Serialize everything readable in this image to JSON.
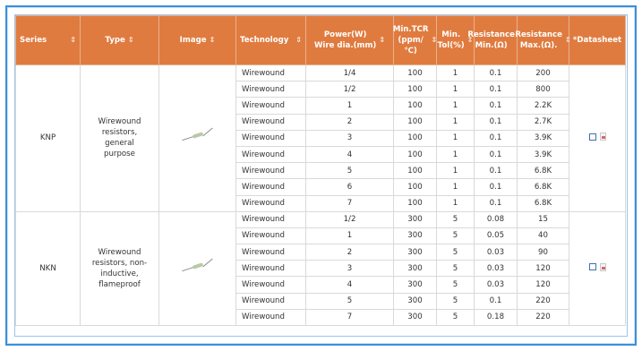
{
  "table": {
    "headers": [
      {
        "key": "series",
        "label": "Series",
        "sort": "⇕"
      },
      {
        "key": "type",
        "label": "Type",
        "sort": "⇕"
      },
      {
        "key": "image",
        "label": "Image",
        "sort": "⇕"
      },
      {
        "key": "technology",
        "label": "Technology",
        "sort": "⇕"
      },
      {
        "key": "power",
        "label": "Power(W)\nWire dia.(mm)",
        "sort": "⇕"
      },
      {
        "key": "tcr",
        "label": "Min.TCR\n(ppm/℃)",
        "sort": "⇕"
      },
      {
        "key": "tol",
        "label": "Min.\nTol(%)",
        "sort": "⇕"
      },
      {
        "key": "rmin",
        "label": "Resistance\nMin.(Ω)",
        "sort": "⇕"
      },
      {
        "key": "rmax",
        "label": "Resistance\nMax.(Ω).",
        "sort": "⇕"
      },
      {
        "key": "datasheet",
        "label": "*Datasheet",
        "sort": ""
      }
    ],
    "groups": [
      {
        "series": "KNP",
        "type": "Wirewound resistors, general purpose",
        "image_icon": "resistor-icon",
        "datasheet_icon": "pdf-icon",
        "rows": [
          {
            "technology": "Wirewound",
            "power": "1/4",
            "tcr": "100",
            "tol": "1",
            "rmin": "0.1",
            "rmax": "200"
          },
          {
            "technology": "Wirewound",
            "power": "1/2",
            "tcr": "100",
            "tol": "1",
            "rmin": "0.1",
            "rmax": "800"
          },
          {
            "technology": "Wirewound",
            "power": "1",
            "tcr": "100",
            "tol": "1",
            "rmin": "0.1",
            "rmax": "2.2K"
          },
          {
            "technology": "Wirewound",
            "power": "2",
            "tcr": "100",
            "tol": "1",
            "rmin": "0.1",
            "rmax": "2.7K"
          },
          {
            "technology": "Wirewound",
            "power": "3",
            "tcr": "100",
            "tol": "1",
            "rmin": "0.1",
            "rmax": "3.9K"
          },
          {
            "technology": "Wirewound",
            "power": "4",
            "tcr": "100",
            "tol": "1",
            "rmin": "0.1",
            "rmax": "3.9K"
          },
          {
            "technology": "Wirewound",
            "power": "5",
            "tcr": "100",
            "tol": "1",
            "rmin": "0.1",
            "rmax": "6.8K"
          },
          {
            "technology": "Wirewound",
            "power": "6",
            "tcr": "100",
            "tol": "1",
            "rmin": "0.1",
            "rmax": "6.8K"
          },
          {
            "technology": "Wirewound",
            "power": "7",
            "tcr": "100",
            "tol": "1",
            "rmin": "0.1",
            "rmax": "6.8K"
          }
        ]
      },
      {
        "series": "NKN",
        "type": "Wirewound resistors, non-inductive, flameproof",
        "image_icon": "resistor-icon",
        "datasheet_icon": "pdf-icon",
        "rows": [
          {
            "technology": "Wirewound",
            "power": "1/2",
            "tcr": "300",
            "tol": "5",
            "rmin": "0.08",
            "rmax": "15"
          },
          {
            "technology": "Wirewound",
            "power": "1",
            "tcr": "300",
            "tol": "5",
            "rmin": "0.05",
            "rmax": "40"
          },
          {
            "technology": "Wirewound",
            "power": "2",
            "tcr": "300",
            "tol": "5",
            "rmin": "0.03",
            "rmax": "90"
          },
          {
            "technology": "Wirewound",
            "power": "3",
            "tcr": "300",
            "tol": "5",
            "rmin": "0.03",
            "rmax": "120"
          },
          {
            "technology": "Wirewound",
            "power": "4",
            "tcr": "300",
            "tol": "5",
            "rmin": "0.03",
            "rmax": "120"
          },
          {
            "technology": "Wirewound",
            "power": "5",
            "tcr": "300",
            "tol": "5",
            "rmin": "0.1",
            "rmax": "220"
          },
          {
            "technology": "Wirewound",
            "power": "7",
            "tcr": "300",
            "tol": "5",
            "rmin": "0.18",
            "rmax": "220"
          }
        ]
      }
    ]
  },
  "colors": {
    "header_bg": "#e07b3f",
    "frame_border": "#3b8fd9",
    "cell_border": "#d9d9d9"
  }
}
